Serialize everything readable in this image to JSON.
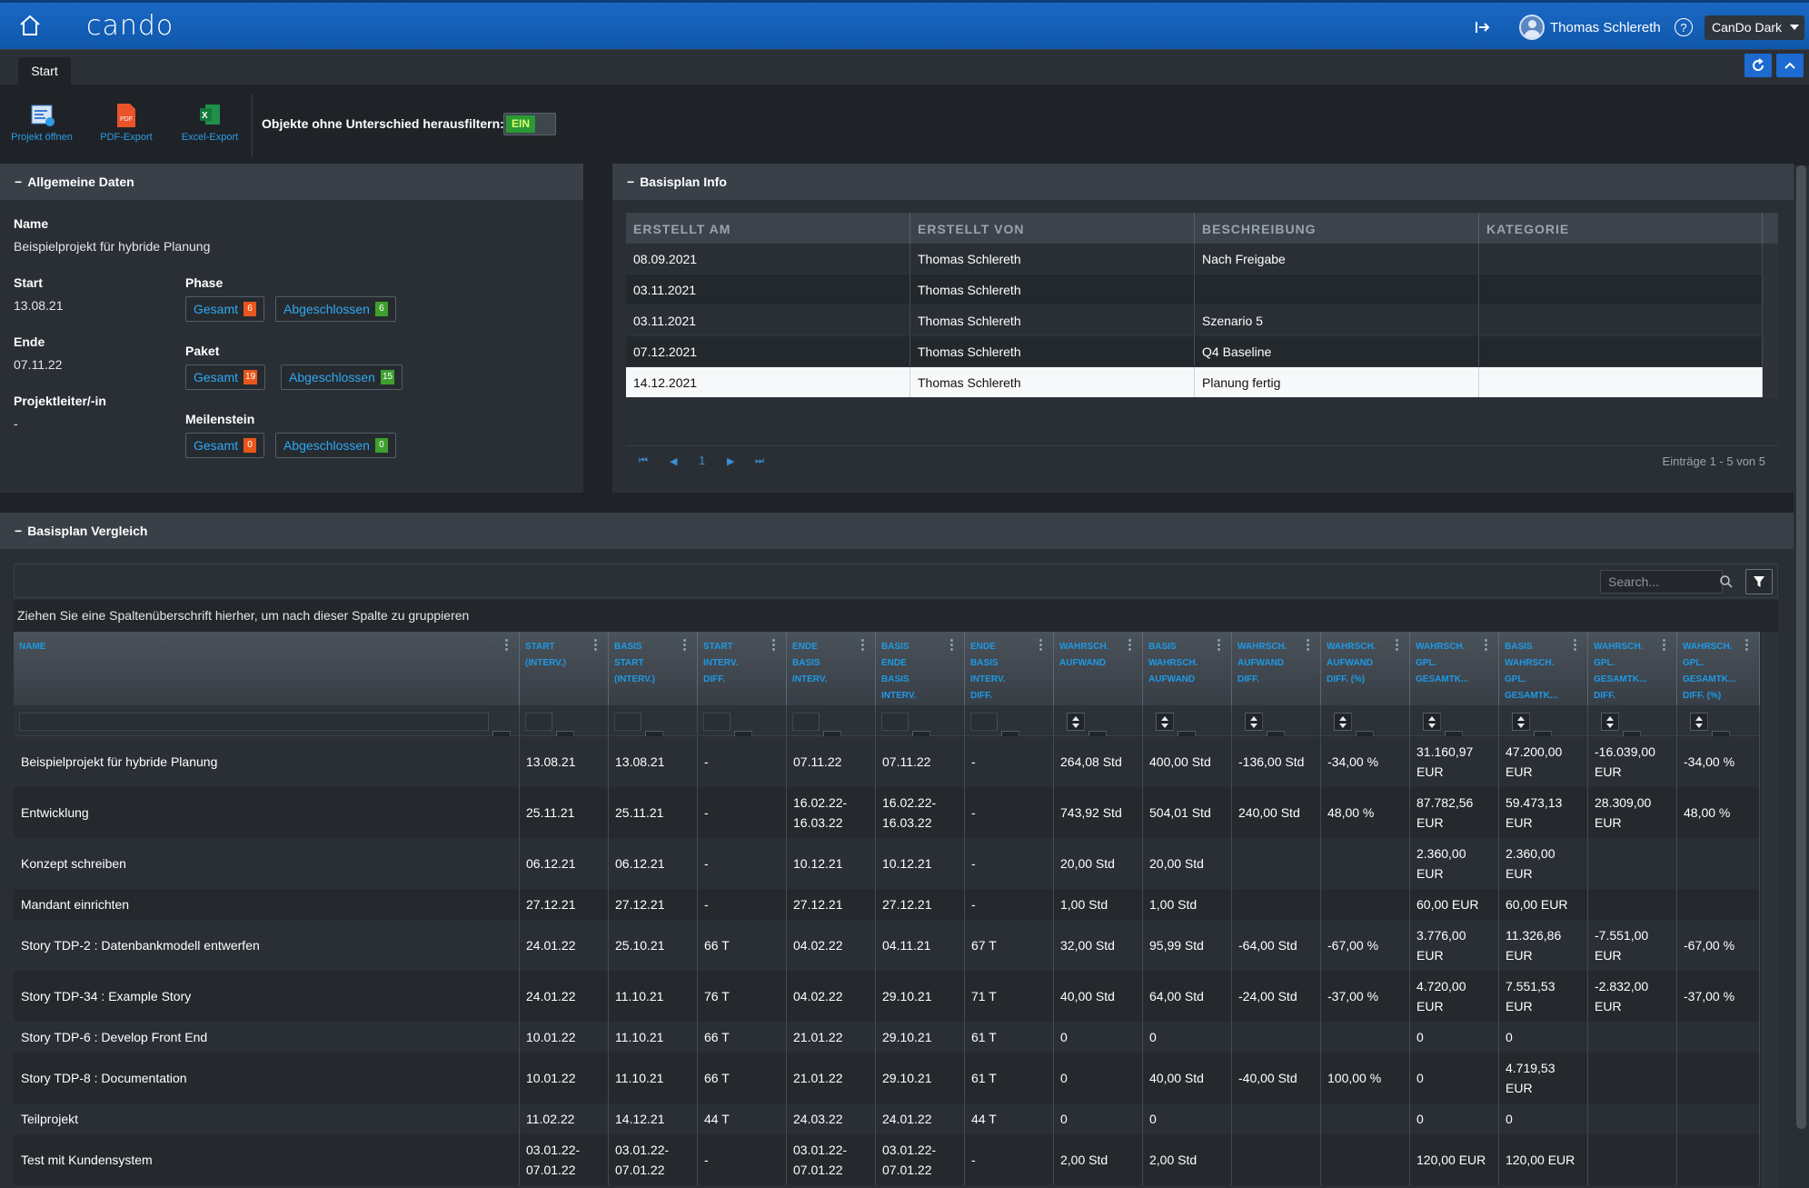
{
  "topbar": {
    "logo": "cando",
    "user_name": "Thomas Schlereth",
    "help": "?",
    "theme": "CanDo Dark"
  },
  "tabs": {
    "start": "Start"
  },
  "ribbon": {
    "open_project": "Projekt öffnen",
    "pdf_export": "PDF-Export",
    "excel_export": "Excel-Export",
    "filter_label": "Objekte ohne Unterschied herausfiltern:",
    "toggle_on": "EIN"
  },
  "allgemein": {
    "title": "Allgemeine Daten",
    "name_label": "Name",
    "name_value": "Beispielprojekt für hybride Planung",
    "start_label": "Start",
    "start_value": "13.08.21",
    "ende_label": "Ende",
    "ende_value": "07.11.22",
    "pl_label": "Projektleiter/-in",
    "pl_value": "-",
    "phase_label": "Phase",
    "paket_label": "Paket",
    "meilenstein_label": "Meilenstein",
    "gesamt": "Gesamt",
    "abgeschlossen": "Abgeschlossen",
    "phase_gesamt": "6",
    "phase_abg": "6",
    "paket_gesamt": "19",
    "paket_abg": "15",
    "ms_gesamt": "0",
    "ms_abg": "0"
  },
  "basisplan_info": {
    "title": "Basisplan Info",
    "columns": [
      "ERSTELLT AM",
      "ERSTELLT VON",
      "BESCHREIBUNG",
      "KATEGORIE"
    ],
    "rows": [
      [
        "08.09.2021",
        "Thomas Schlereth",
        "Nach Freigabe",
        ""
      ],
      [
        "03.11.2021",
        "Thomas Schlereth",
        "",
        ""
      ],
      [
        "03.11.2021",
        "Thomas Schlereth",
        "Szenario 5",
        ""
      ],
      [
        "07.12.2021",
        "Thomas Schlereth",
        "Q4 Baseline",
        ""
      ],
      [
        "14.12.2021",
        "Thomas Schlereth",
        "Planung fertig",
        ""
      ]
    ],
    "page": "1",
    "entries": "Einträge 1 - 5 von 5"
  },
  "vergleich": {
    "title": "Basisplan Vergleich",
    "search_placeholder": "Search...",
    "group_hint": "Ziehen Sie eine Spaltenüberschrift hierher, um nach dieser Spalte zu gruppieren",
    "columns": [
      [
        "NAME"
      ],
      [
        "START",
        "(INTERV.)"
      ],
      [
        "BASIS",
        "START",
        "(INTERV.)"
      ],
      [
        "START",
        "INTERV.",
        "DIFF."
      ],
      [
        "ENDE",
        "BASIS",
        "INTERV."
      ],
      [
        "BASIS",
        "ENDE",
        "BASIS",
        "INTERV."
      ],
      [
        "ENDE",
        "BASIS",
        "INTERV.",
        "DIFF."
      ],
      [
        "WAHRSCH.",
        "AUFWAND"
      ],
      [
        "BASIS",
        "WAHRSCH.",
        "AUFWAND"
      ],
      [
        "WAHRSCH.",
        "AUFWAND",
        "DIFF."
      ],
      [
        "WAHRSCH.",
        "AUFWAND",
        "DIFF. (%)"
      ],
      [
        "WAHRSCH.",
        "GPL.",
        "GESAMTK..."
      ],
      [
        "BASIS",
        "WAHRSCH.",
        "GPL.",
        "GESAMTK..."
      ],
      [
        "WAHRSCH.",
        "GPL.",
        "GESAMTK...",
        "DIFF."
      ],
      [
        "WAHRSCH.",
        "GPL.",
        "GESAMTK...",
        "DIFF. (%)"
      ]
    ],
    "rows": [
      [
        "Beispielprojekt für hybride Planung",
        "13.08.21",
        "13.08.21",
        "-",
        "07.11.22",
        "07.11.22",
        "-",
        "264,08 Std",
        "400,00 Std",
        "-136,00 Std",
        "-34,00 %",
        "31.160,97 EUR",
        "47.200,00 EUR",
        "-16.039,00 EUR",
        "-34,00 %"
      ],
      [
        "Entwicklung",
        "25.11.21",
        "25.11.21",
        "-",
        "16.02.22-16.03.22",
        "16.02.22-16.03.22",
        "-",
        "743,92 Std",
        "504,01 Std",
        "240,00 Std",
        "48,00 %",
        "87.782,56 EUR",
        "59.473,13 EUR",
        "28.309,00 EUR",
        "48,00 %"
      ],
      [
        "Konzept schreiben",
        "06.12.21",
        "06.12.21",
        "-",
        "10.12.21",
        "10.12.21",
        "-",
        "20,00 Std",
        "20,00 Std",
        "",
        "",
        "2.360,00 EUR",
        "2.360,00 EUR",
        "",
        ""
      ],
      [
        "Mandant einrichten",
        "27.12.21",
        "27.12.21",
        "-",
        "27.12.21",
        "27.12.21",
        "-",
        "1,00 Std",
        "1,00 Std",
        "",
        "",
        "60,00 EUR",
        "60,00 EUR",
        "",
        ""
      ],
      [
        "Story TDP-2 : Datenbankmodell entwerfen",
        "24.01.22",
        "25.10.21",
        "66 T",
        "04.02.22",
        "04.11.21",
        "67 T",
        "32,00 Std",
        "95,99 Std",
        "-64,00 Std",
        "-67,00 %",
        "3.776,00 EUR",
        "11.326,86 EUR",
        "-7.551,00 EUR",
        "-67,00 %"
      ],
      [
        "Story TDP-34 : Example Story",
        "24.01.22",
        "11.10.21",
        "76 T",
        "04.02.22",
        "29.10.21",
        "71 T",
        "40,00 Std",
        "64,00 Std",
        "-24,00 Std",
        "-37,00 %",
        "4.720,00 EUR",
        "7.551,53 EUR",
        "-2.832,00 EUR",
        "-37,00 %"
      ],
      [
        "Story TDP-6 : Develop Front End",
        "10.01.22",
        "11.10.21",
        "66 T",
        "21.01.22",
        "29.10.21",
        "61 T",
        "0",
        "0",
        "",
        "",
        "0",
        "0",
        "",
        ""
      ],
      [
        "Story TDP-8 : Documentation",
        "10.01.22",
        "11.10.21",
        "66 T",
        "21.01.22",
        "29.10.21",
        "61 T",
        "0",
        "40,00 Std",
        "-40,00 Std",
        "100,00 %",
        "0",
        "4.719,53 EUR",
        "",
        ""
      ],
      [
        "Teilprojekt",
        "11.02.22",
        "14.12.21",
        "44 T",
        "24.03.22",
        "24.01.22",
        "44 T",
        "0",
        "0",
        "",
        "",
        "0",
        "0",
        "",
        ""
      ],
      [
        "Test mit Kundensystem",
        "03.01.22-07.01.22",
        "03.01.22-07.01.22",
        "-",
        "03.01.22-07.01.22",
        "03.01.22-07.01.22",
        "-",
        "2,00 Std",
        "2,00 Std",
        "",
        "",
        "120,00 EUR",
        "120,00 EUR",
        "",
        ""
      ]
    ]
  }
}
